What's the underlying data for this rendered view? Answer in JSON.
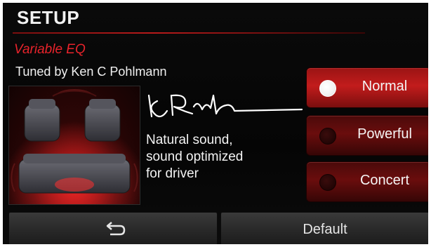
{
  "header": {
    "title": "SETUP",
    "subtitle": "Variable EQ"
  },
  "info": {
    "tuned_by": "Tuned by Ken C Pohlmann",
    "signature": "Ken C Pohlmann",
    "description_lines": [
      "Natural sound,",
      "sound optimized",
      "for driver"
    ]
  },
  "modes": [
    {
      "label": "Normal",
      "selected": true
    },
    {
      "label": "Powerful",
      "selected": false
    },
    {
      "label": "Concert",
      "selected": false
    }
  ],
  "footer": {
    "back_icon": "back-arrow-icon",
    "default_label": "Default"
  },
  "colors": {
    "accent": "#e8232b",
    "selected_button": "#c21c1c",
    "button": "#6a0d0d"
  }
}
